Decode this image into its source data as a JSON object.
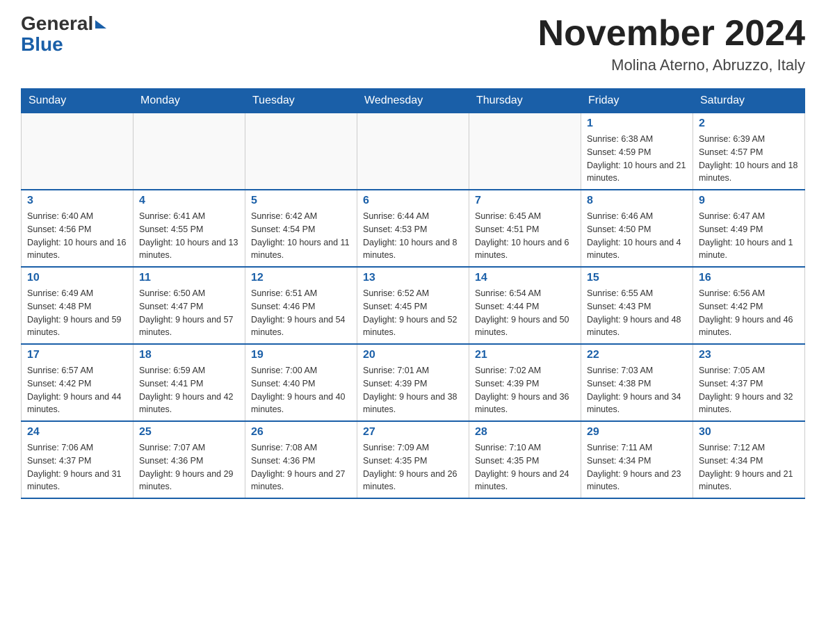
{
  "header": {
    "logo_general": "General",
    "logo_blue": "Blue",
    "month_title": "November 2024",
    "location": "Molina Aterno, Abruzzo, Italy"
  },
  "calendar": {
    "days_of_week": [
      "Sunday",
      "Monday",
      "Tuesday",
      "Wednesday",
      "Thursday",
      "Friday",
      "Saturday"
    ],
    "weeks": [
      [
        {
          "day": "",
          "info": ""
        },
        {
          "day": "",
          "info": ""
        },
        {
          "day": "",
          "info": ""
        },
        {
          "day": "",
          "info": ""
        },
        {
          "day": "",
          "info": ""
        },
        {
          "day": "1",
          "info": "Sunrise: 6:38 AM\nSunset: 4:59 PM\nDaylight: 10 hours and 21 minutes."
        },
        {
          "day": "2",
          "info": "Sunrise: 6:39 AM\nSunset: 4:57 PM\nDaylight: 10 hours and 18 minutes."
        }
      ],
      [
        {
          "day": "3",
          "info": "Sunrise: 6:40 AM\nSunset: 4:56 PM\nDaylight: 10 hours and 16 minutes."
        },
        {
          "day": "4",
          "info": "Sunrise: 6:41 AM\nSunset: 4:55 PM\nDaylight: 10 hours and 13 minutes."
        },
        {
          "day": "5",
          "info": "Sunrise: 6:42 AM\nSunset: 4:54 PM\nDaylight: 10 hours and 11 minutes."
        },
        {
          "day": "6",
          "info": "Sunrise: 6:44 AM\nSunset: 4:53 PM\nDaylight: 10 hours and 8 minutes."
        },
        {
          "day": "7",
          "info": "Sunrise: 6:45 AM\nSunset: 4:51 PM\nDaylight: 10 hours and 6 minutes."
        },
        {
          "day": "8",
          "info": "Sunrise: 6:46 AM\nSunset: 4:50 PM\nDaylight: 10 hours and 4 minutes."
        },
        {
          "day": "9",
          "info": "Sunrise: 6:47 AM\nSunset: 4:49 PM\nDaylight: 10 hours and 1 minute."
        }
      ],
      [
        {
          "day": "10",
          "info": "Sunrise: 6:49 AM\nSunset: 4:48 PM\nDaylight: 9 hours and 59 minutes."
        },
        {
          "day": "11",
          "info": "Sunrise: 6:50 AM\nSunset: 4:47 PM\nDaylight: 9 hours and 57 minutes."
        },
        {
          "day": "12",
          "info": "Sunrise: 6:51 AM\nSunset: 4:46 PM\nDaylight: 9 hours and 54 minutes."
        },
        {
          "day": "13",
          "info": "Sunrise: 6:52 AM\nSunset: 4:45 PM\nDaylight: 9 hours and 52 minutes."
        },
        {
          "day": "14",
          "info": "Sunrise: 6:54 AM\nSunset: 4:44 PM\nDaylight: 9 hours and 50 minutes."
        },
        {
          "day": "15",
          "info": "Sunrise: 6:55 AM\nSunset: 4:43 PM\nDaylight: 9 hours and 48 minutes."
        },
        {
          "day": "16",
          "info": "Sunrise: 6:56 AM\nSunset: 4:42 PM\nDaylight: 9 hours and 46 minutes."
        }
      ],
      [
        {
          "day": "17",
          "info": "Sunrise: 6:57 AM\nSunset: 4:42 PM\nDaylight: 9 hours and 44 minutes."
        },
        {
          "day": "18",
          "info": "Sunrise: 6:59 AM\nSunset: 4:41 PM\nDaylight: 9 hours and 42 minutes."
        },
        {
          "day": "19",
          "info": "Sunrise: 7:00 AM\nSunset: 4:40 PM\nDaylight: 9 hours and 40 minutes."
        },
        {
          "day": "20",
          "info": "Sunrise: 7:01 AM\nSunset: 4:39 PM\nDaylight: 9 hours and 38 minutes."
        },
        {
          "day": "21",
          "info": "Sunrise: 7:02 AM\nSunset: 4:39 PM\nDaylight: 9 hours and 36 minutes."
        },
        {
          "day": "22",
          "info": "Sunrise: 7:03 AM\nSunset: 4:38 PM\nDaylight: 9 hours and 34 minutes."
        },
        {
          "day": "23",
          "info": "Sunrise: 7:05 AM\nSunset: 4:37 PM\nDaylight: 9 hours and 32 minutes."
        }
      ],
      [
        {
          "day": "24",
          "info": "Sunrise: 7:06 AM\nSunset: 4:37 PM\nDaylight: 9 hours and 31 minutes."
        },
        {
          "day": "25",
          "info": "Sunrise: 7:07 AM\nSunset: 4:36 PM\nDaylight: 9 hours and 29 minutes."
        },
        {
          "day": "26",
          "info": "Sunrise: 7:08 AM\nSunset: 4:36 PM\nDaylight: 9 hours and 27 minutes."
        },
        {
          "day": "27",
          "info": "Sunrise: 7:09 AM\nSunset: 4:35 PM\nDaylight: 9 hours and 26 minutes."
        },
        {
          "day": "28",
          "info": "Sunrise: 7:10 AM\nSunset: 4:35 PM\nDaylight: 9 hours and 24 minutes."
        },
        {
          "day": "29",
          "info": "Sunrise: 7:11 AM\nSunset: 4:34 PM\nDaylight: 9 hours and 23 minutes."
        },
        {
          "day": "30",
          "info": "Sunrise: 7:12 AM\nSunset: 4:34 PM\nDaylight: 9 hours and 21 minutes."
        }
      ]
    ]
  }
}
